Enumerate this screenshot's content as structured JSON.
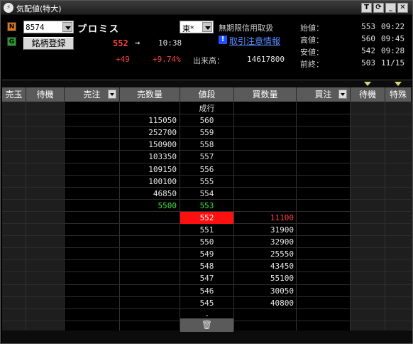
{
  "window": {
    "title": "気配値(特大)",
    "buttons": [
      "T",
      "⟳",
      "_",
      "✕"
    ]
  },
  "header": {
    "badge_n": "N",
    "badge_g": "G",
    "code": "8574",
    "stock_name": "プロミス",
    "register_label": "銘柄登録",
    "price": "552",
    "arrow": "→",
    "price_time": "10:38",
    "change": "+49",
    "change_pct": "+9.74%",
    "market": "東*",
    "margin_type": "無期限信用取扱",
    "info_icon": "!",
    "caution_link": "取引注意情報",
    "volume_label": "出来高：",
    "volume": "14617800",
    "ohlc": [
      {
        "label": "始値：",
        "value": "553",
        "time": "09:22"
      },
      {
        "label": "高値：",
        "value": "560",
        "time": "09:45"
      },
      {
        "label": "安値：",
        "value": "542",
        "time": "09:28"
      },
      {
        "label": "前終：",
        "value": "503",
        "time": "11/15"
      }
    ]
  },
  "columns": {
    "sell_margin": "売玉",
    "wait_left": "待機",
    "sell_order": "売注",
    "sell_qty": "売数量",
    "price": "値段",
    "buy_qty": "買数量",
    "buy_order": "買注",
    "wait_right": "待機",
    "special": "特殊"
  },
  "board": {
    "market_order_label": "成行",
    "asks": [
      {
        "price": "560",
        "qty": "115050"
      },
      {
        "price": "559",
        "qty": "252700"
      },
      {
        "price": "558",
        "qty": "150900"
      },
      {
        "price": "557",
        "qty": "103350"
      },
      {
        "price": "556",
        "qty": "109150"
      },
      {
        "price": "555",
        "qty": "100100"
      },
      {
        "price": "554",
        "qty": "46850"
      },
      {
        "price": "553",
        "qty": "5500"
      }
    ],
    "bids": [
      {
        "price": "552",
        "qty": "11100"
      },
      {
        "price": "551",
        "qty": "31900"
      },
      {
        "price": "550",
        "qty": "32900"
      },
      {
        "price": "549",
        "qty": "25550"
      },
      {
        "price": "548",
        "qty": "43450"
      },
      {
        "price": "547",
        "qty": "55100"
      },
      {
        "price": "546",
        "qty": "30050"
      },
      {
        "price": "545",
        "qty": "40800"
      }
    ],
    "bottom_price": "-",
    "trash_icon": "🗑"
  },
  "colors": {
    "up": "#ff4040",
    "best_ask": "#40e040",
    "current_price_bg": "#ff1010",
    "link": "#5a8cff"
  }
}
